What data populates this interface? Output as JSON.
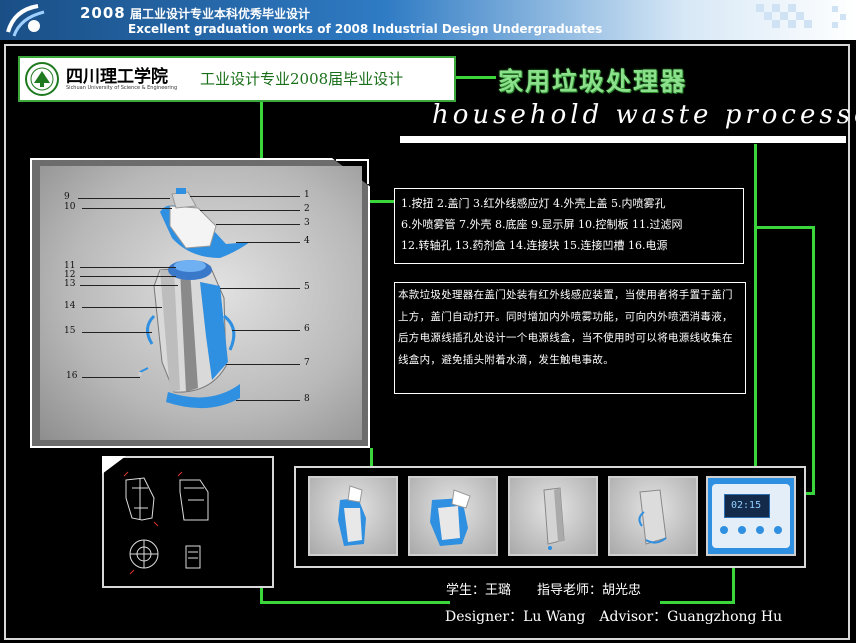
{
  "banner": {
    "year": "2008",
    "title_cn": "届工业设计专业本科优秀毕业设计",
    "title_en": "Excellent graduation works of 2008 Industrial Design Undergraduates"
  },
  "school": {
    "name": "四川理工学院",
    "sub": "Sichuan University of Science & Engineering",
    "major": "工业设计专业2008届毕业设计"
  },
  "title": {
    "cn": "家用垃圾处理器",
    "en": "household waste processor"
  },
  "callouts": {
    "left": [
      "9",
      "10",
      "11",
      "12",
      "13",
      "14",
      "15",
      "16"
    ],
    "right": [
      "1",
      "2",
      "3",
      "4",
      "5",
      "6",
      "7",
      "8"
    ]
  },
  "parts": {
    "line1": "1.按扭 2.盖门 3.红外线感应灯 4.外壳上盖 5.内喷雾孔",
    "line2": "6.外喷雾管 7.外壳 8.底座 9.显示屏 10.控制板 11.过滤网",
    "line3": "12.转轴孔 13.药剂盒 14.连接块 15.连接凹槽 16.电源"
  },
  "description": "本款垃圾处理器在盖门处装有红外线感应装置，当使用者将手置于盖门上方，盖门自动打开。同时增加内外喷雾功能，可向内外喷洒消毒液，后方电源线插孔处设计一个电源线盒，当不使用时可以将电源线收集在线盒内，避免插头附着水滴，发生触电事故。",
  "display": {
    "time": "02:15"
  },
  "credits": {
    "student": "学生：王璐　　指导老师：胡光忠",
    "designer": "Designer：Lu Wang　Advisor：Guangzhong Hu"
  },
  "colors": {
    "accent_green": "#3bd63b",
    "product_blue": "#2f8fe0",
    "banner_blue": "#2f7bc4"
  }
}
